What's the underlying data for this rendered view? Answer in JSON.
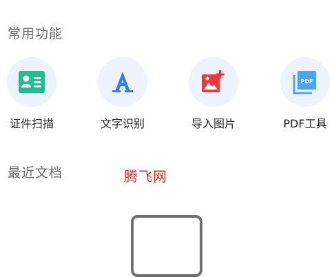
{
  "common": {
    "title": "常用功能",
    "items": [
      {
        "label": "证件扫描",
        "icon": "id-card-icon",
        "color": "#1fbf8f"
      },
      {
        "label": "文字识别",
        "icon": "text-recognition-icon",
        "color": "#2f7ff2"
      },
      {
        "label": "导入图片",
        "icon": "import-image-icon",
        "color": "#f0363b"
      },
      {
        "label": "PDF工具",
        "icon": "pdf-tool-icon",
        "color": "#4aa6f0"
      }
    ]
  },
  "recent": {
    "title": "最近文档"
  },
  "watermark": "腾飞网"
}
